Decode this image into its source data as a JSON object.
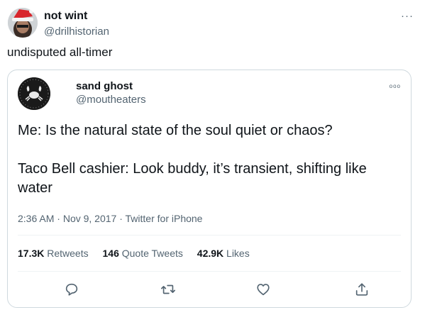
{
  "outer_tweet": {
    "author_name": "not wint",
    "author_handle": "@drilhistorian",
    "more_glyph": "···",
    "text": "undisputed all-timer"
  },
  "quoted_tweet": {
    "author_name": "sand ghost",
    "author_handle": "@moutheaters",
    "more_glyph": "ooo",
    "text": "Me: Is the natural state of the soul quiet or chaos?\n\nTaco Bell cashier: Look buddy, it’s transient, shifting like water",
    "time": "2:36 AM",
    "date": "Nov 9, 2017",
    "source": "Twitter for iPhone",
    "separator": " · ",
    "stats": {
      "retweets_count": "17.3K",
      "retweets_label": "Retweets",
      "quotes_count": "146",
      "quotes_label": "Quote Tweets",
      "likes_count": "42.9K",
      "likes_label": "Likes"
    },
    "actions": [
      "reply-icon",
      "retweet-icon",
      "like-icon",
      "share-icon"
    ]
  },
  "colors": {
    "text_primary": "#0f1419",
    "text_secondary": "#536471",
    "border": "#cfd9de",
    "divider": "#eff3f4",
    "santa_hat_red": "#d8262c"
  }
}
